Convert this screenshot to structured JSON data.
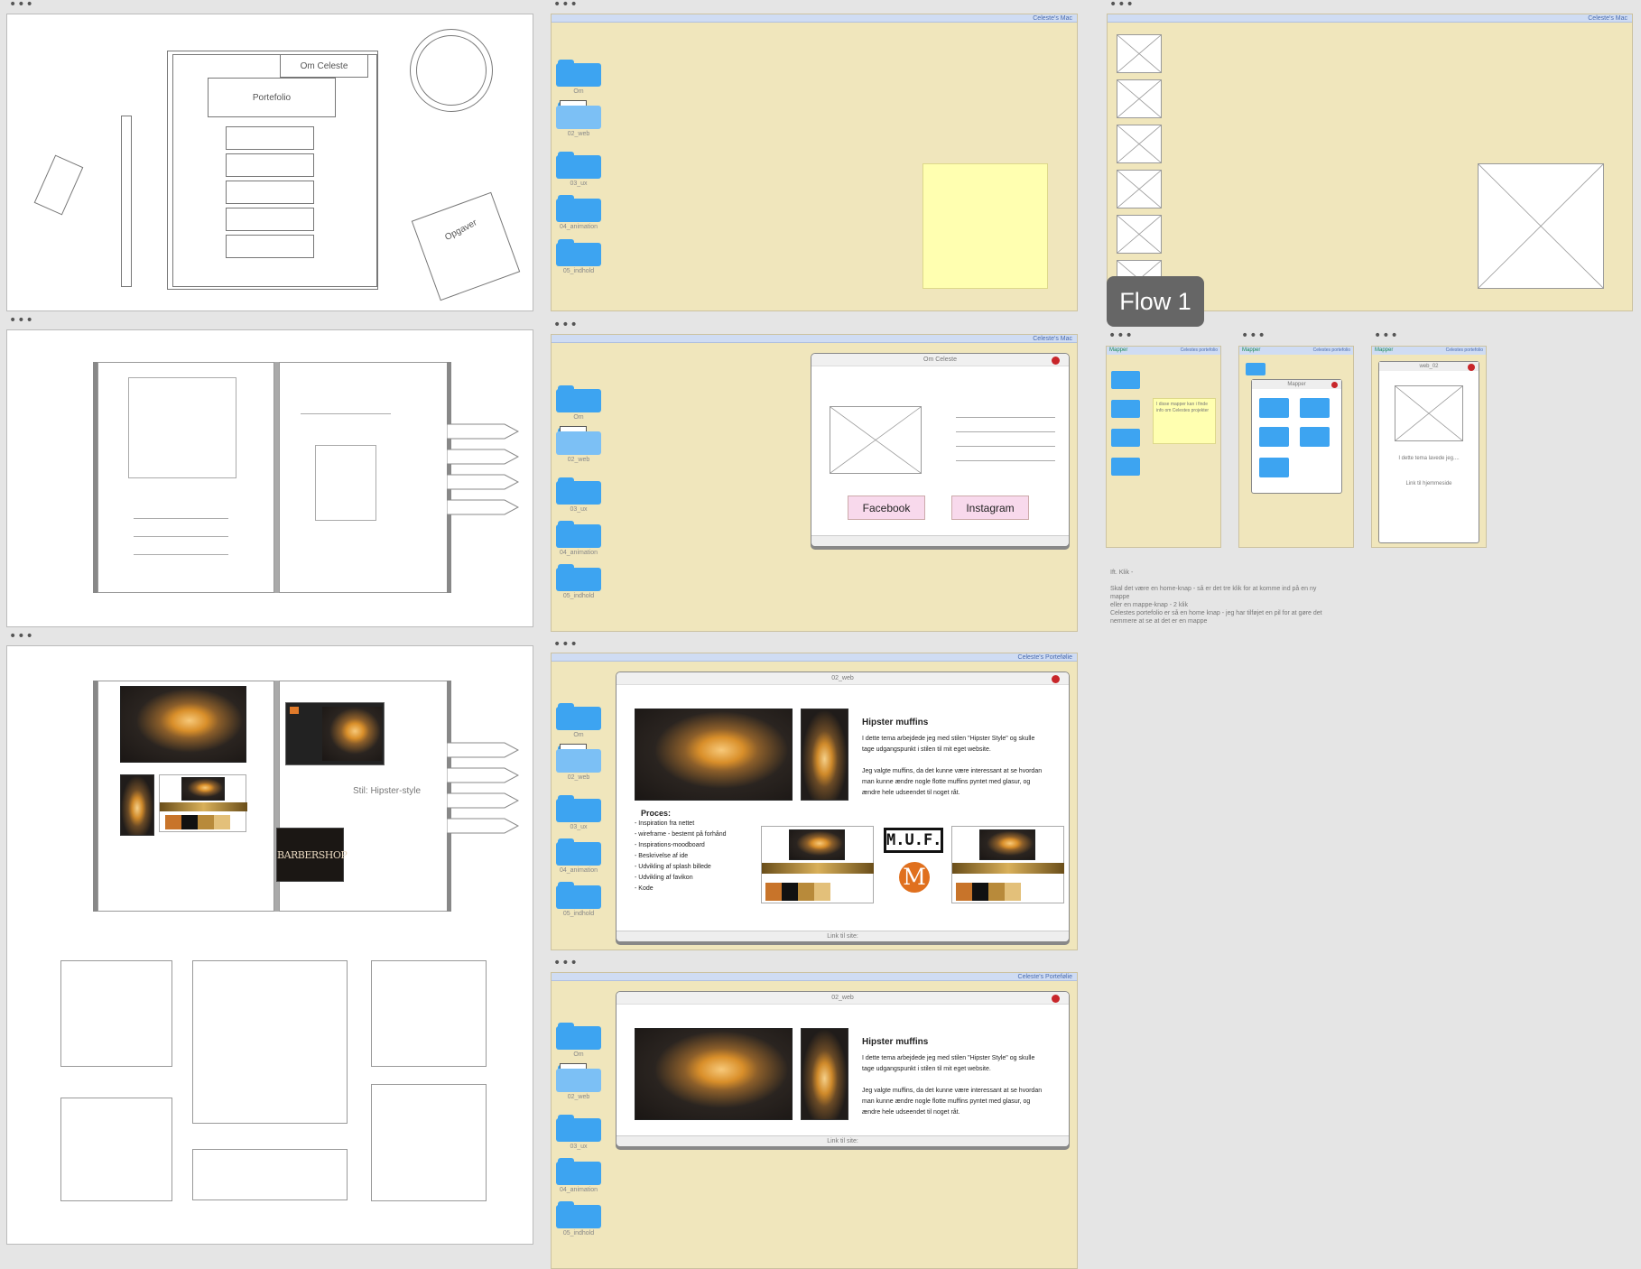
{
  "mac1": {
    "menubar": "Celeste's Mac"
  },
  "mac2": {
    "menubar": "Celeste's Mac"
  },
  "mac3": {
    "menubar": "Celeste's Mac"
  },
  "mac4": {
    "menubar": "Celeste's Portefølie"
  },
  "mac5": {
    "menubar": "Celeste's Portefølie"
  },
  "folders": [
    "Om",
    "02_web",
    "03_ux",
    "04_animation",
    "05_indhold"
  ],
  "sketch1": {
    "om": "Om Celeste",
    "portfolio": "Portefolio",
    "tasks": "Opgaver"
  },
  "sketch3": {
    "style": "Stil: Hipster-style"
  },
  "om_window": {
    "title": "Om Celeste",
    "facebook": "Facebook",
    "instagram": "Instagram"
  },
  "web_window": {
    "title": "02_web",
    "heading": "Hipster muffins",
    "p1": "I dette tema arbejdede jeg med stilen \"Hipster Style\" og skulle tage udgangspunkt i stilen til mit eget website.",
    "p2": "Jeg valgte muffins, da det kunne være interessant at se hvordan man kunne ændre nogle flotte muffins pyntet med glasur, og ændre hele udseendet til noget råt.",
    "process_title": "Proces:",
    "process": [
      "- Inspiration fra nettet",
      "- wireframe - bestemt på forhånd",
      "- Inspirations-moodboard",
      "- Beskrivelse af ide",
      "- Udvikling af splash billede",
      "- Udvikling af favikon",
      "- Kode"
    ],
    "footer": "Link til site:",
    "muf_logo": "M.U.F."
  },
  "flow_label": "Flow 1",
  "small_frames": {
    "f1": {
      "left": "Mapper",
      "right": "Celestes portefolio",
      "note": "I disse mapper kan i finde info om Celestes projekter"
    },
    "f2": {
      "left": "Mapper",
      "right": "Celestes portefolio",
      "window": "Mapper"
    },
    "f3": {
      "left": "Mapper",
      "right": "Celestes portefolio",
      "window": "web_02",
      "text": "I dette tema lavede jeg....",
      "link": "Link til hjemmeside"
    }
  },
  "annotation": {
    "l1": "Ift. Klik -",
    "l2": "Skal det være en home-knap - så er det tre klik for at komme ind på en ny mappe",
    "l3": "eller en mappe-knap - 2 klik",
    "l4": "Celestes portefolio er så en home knap - jeg har tilføjet en pil for at gøre det nemmere at se at det er en mappe"
  },
  "barbershop": "BARBERSHOP"
}
